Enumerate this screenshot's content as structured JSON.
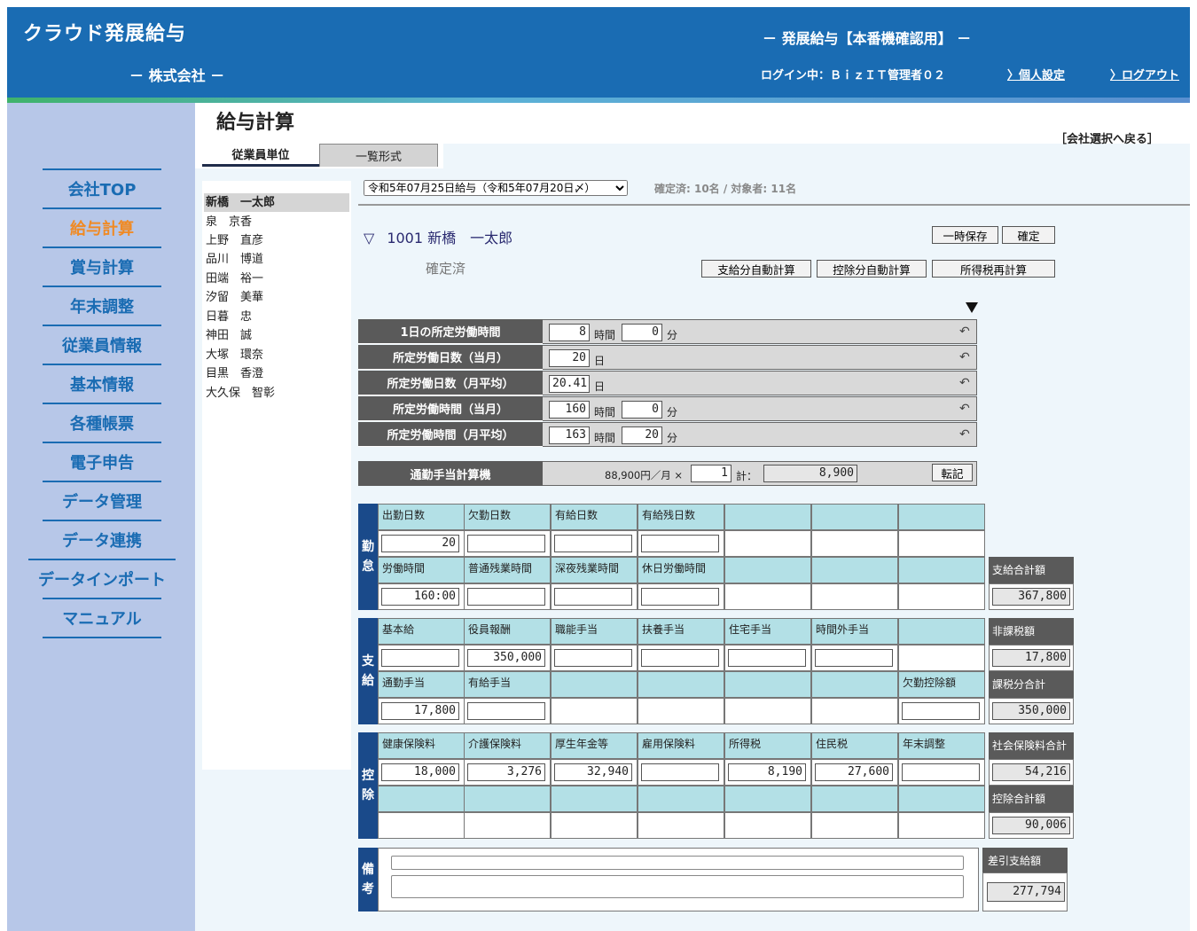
{
  "header": {
    "app_title": "クラウド発展給与",
    "company": "－ 株式会社 －",
    "system_title": "－ 発展給与【本番機確認用】 －",
    "login_info": "ログイン中：ＢｉｚＩＴ管理者０２",
    "personal_settings": "〉個人設定",
    "logout": "〉ログアウト"
  },
  "sidebar": {
    "items": [
      {
        "label": "会社TOP",
        "active": false
      },
      {
        "label": "給与計算",
        "active": true
      },
      {
        "label": "賞与計算",
        "active": false
      },
      {
        "label": "年末調整",
        "active": false
      },
      {
        "label": "従業員情報",
        "active": false
      },
      {
        "label": "基本情報",
        "active": false
      },
      {
        "label": "各種帳票",
        "active": false
      },
      {
        "label": "電子申告",
        "active": false
      },
      {
        "label": "データ管理",
        "active": false
      },
      {
        "label": "データ連携",
        "active": false
      },
      {
        "label": "データインポート",
        "active": false
      },
      {
        "label": "マニュアル",
        "active": false
      }
    ]
  },
  "page": {
    "title": "給与計算",
    "back_link": "［会社選択へ戻る］",
    "tabs": [
      "従業員単位",
      "一覧形式"
    ]
  },
  "employees": [
    "新橋　一太郎",
    "泉　京香",
    "上野　直彦",
    "品川　博道",
    "田端　裕一",
    "汐留　美華",
    "日暮　忠",
    "神田　誠",
    "大塚　環奈",
    "目黒　香澄",
    "大久保　智彰"
  ],
  "period": {
    "selected": "令和5年07月25日給与（令和5年07月20日〆）",
    "status": "確定済: 10名 / 対象者: 11名"
  },
  "employee_header": {
    "toggle": "▽",
    "code_name": "1001 新橋　一太郎",
    "status": "確定済"
  },
  "buttons": {
    "temp_save": "一時保存",
    "confirm": "確定",
    "auto_pay": "支給分自動計算",
    "auto_deduct": "控除分自動計算",
    "recalc_tax": "所得税再計算"
  },
  "work_hours": [
    {
      "label": "1日の所定労働時間",
      "v1": "8",
      "u1": "時間",
      "v2": "0",
      "u2": "分"
    },
    {
      "label": "所定労働日数（当月）",
      "v1": "20",
      "u1": "日"
    },
    {
      "label": "所定労働日数（月平均）",
      "v1": "20.41",
      "u1": "日"
    },
    {
      "label": "所定労働時間（当月）",
      "v1": "160",
      "u1": "時間",
      "v2": "0",
      "u2": "分"
    },
    {
      "label": "所定労働時間（月平均）",
      "v1": "163",
      "u1": "時間",
      "v2": "20",
      "u2": "分"
    }
  ],
  "commute": {
    "label": "通勤手当計算機",
    "rate": "88,900円／月 ×",
    "qty": "1",
    "total_label": "計：",
    "total": "8,900",
    "transfer_button": "転記"
  },
  "sections": {
    "attendance": {
      "label": [
        "勤",
        "怠"
      ],
      "row1": [
        {
          "h": "出勤日数",
          "v": "20"
        },
        {
          "h": "欠勤日数",
          "v": ""
        },
        {
          "h": "有給日数",
          "v": ""
        },
        {
          "h": "有給残日数",
          "v": ""
        }
      ],
      "row2": [
        {
          "h": "労働時間",
          "v": "160:00"
        },
        {
          "h": "普通残業時間",
          "v": ""
        },
        {
          "h": "深夜残業時間",
          "v": ""
        },
        {
          "h": "休日労働時間",
          "v": ""
        }
      ]
    },
    "payment": {
      "label": [
        "支",
        "給"
      ],
      "row1": [
        {
          "h": "基本給",
          "v": ""
        },
        {
          "h": "役員報酬",
          "v": "350,000"
        },
        {
          "h": "職能手当",
          "v": ""
        },
        {
          "h": "扶養手当",
          "v": ""
        },
        {
          "h": "住宅手当",
          "v": ""
        },
        {
          "h": "時間外手当",
          "v": ""
        }
      ],
      "row2": [
        {
          "h": "通勤手当",
          "v": "17,800"
        },
        {
          "h": "有給手当",
          "v": ""
        }
      ],
      "absence_deduction": {
        "h": "欠勤控除額",
        "v": ""
      }
    },
    "deduction": {
      "label": [
        "控",
        "除"
      ],
      "row1": [
        {
          "h": "健康保険料",
          "v": "18,000"
        },
        {
          "h": "介護保険料",
          "v": "3,276"
        },
        {
          "h": "厚生年金等",
          "v": "32,940"
        },
        {
          "h": "雇用保険料",
          "v": ""
        },
        {
          "h": "所得税",
          "v": "8,190"
        },
        {
          "h": "住民税",
          "v": "27,600"
        },
        {
          "h": "年末調整",
          "v": ""
        }
      ]
    }
  },
  "totals": [
    {
      "label": "支給合計額",
      "value": "367,800"
    },
    {
      "label": "非課税額",
      "value": "17,800"
    },
    {
      "label": "課税分合計",
      "value": "350,000"
    },
    {
      "label": "社会保険料合計",
      "value": "54,216"
    },
    {
      "label": "控除合計額",
      "value": "90,006"
    }
  ],
  "remarks": {
    "label": [
      "備",
      "考"
    ]
  },
  "net_pay": {
    "label": "差引支給額",
    "value": "277,794"
  }
}
